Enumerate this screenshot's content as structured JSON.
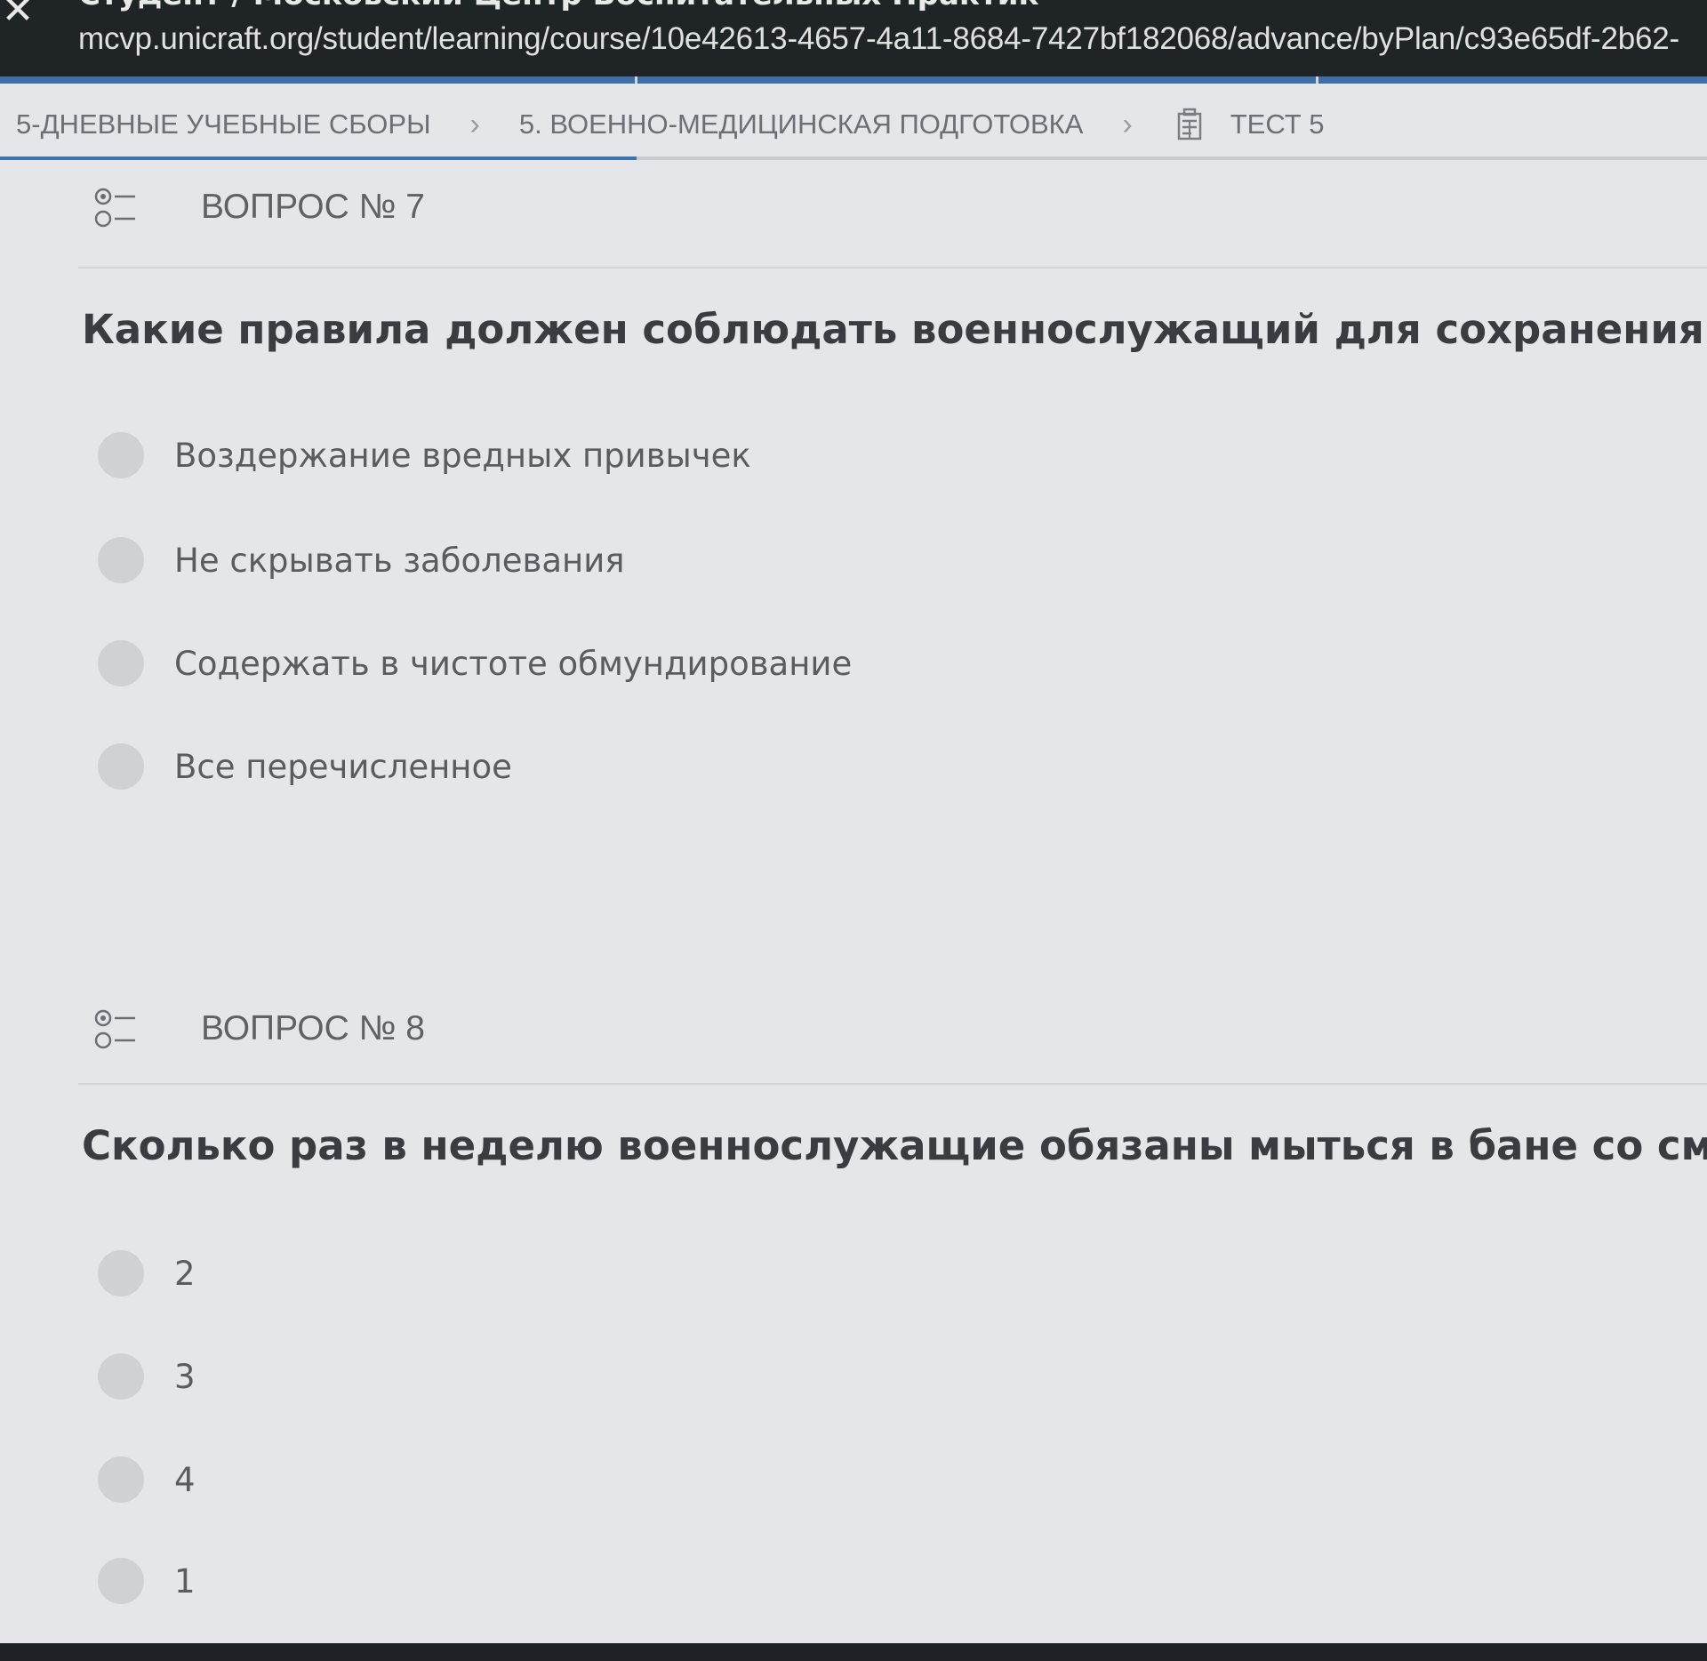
{
  "browser": {
    "close_glyph": "✕",
    "title": "Студент / Московский Центр Воспитательных Практик",
    "url": "mcvp.unicraft.org/student/learning/course/10e42613-4657-4a11-8684-7427bf182068/advance/byPlan/c93e65df-2b62-"
  },
  "breadcrumb": {
    "items": [
      {
        "label": "5-ДНЕВНЫЕ УЧЕБНЫЕ СБОРЫ"
      },
      {
        "label": "5. ВОЕННО-МЕДИЦИНСКАЯ ПОДГОТОВКА"
      },
      {
        "label": "ТЕСТ 5",
        "icon": "test-sheet-icon"
      }
    ],
    "separator": "›"
  },
  "questions": [
    {
      "header": "ВОПРОС № 7",
      "icon": "radio-list-icon",
      "text": "Какие правила должен соблюдать военнослужащий для сохранения здоровья?",
      "options": [
        "Воздержание вредных привычек",
        "Не скрывать заболевания",
        "Содержать в чистоте обмундирование",
        "Все перечисленное"
      ]
    },
    {
      "header": "ВОПРОС № 8",
      "icon": "radio-list-icon",
      "text": "Сколько раз в неделю военнослужащие обязаны мыться в бане со сменой белья?",
      "options": [
        "2",
        "3",
        "4",
        "1"
      ]
    }
  ],
  "colors": {
    "background": "#e4e6ea",
    "topbar": "#1f2427",
    "accent": "#3e72aa",
    "radio": "#cfd1d5"
  }
}
